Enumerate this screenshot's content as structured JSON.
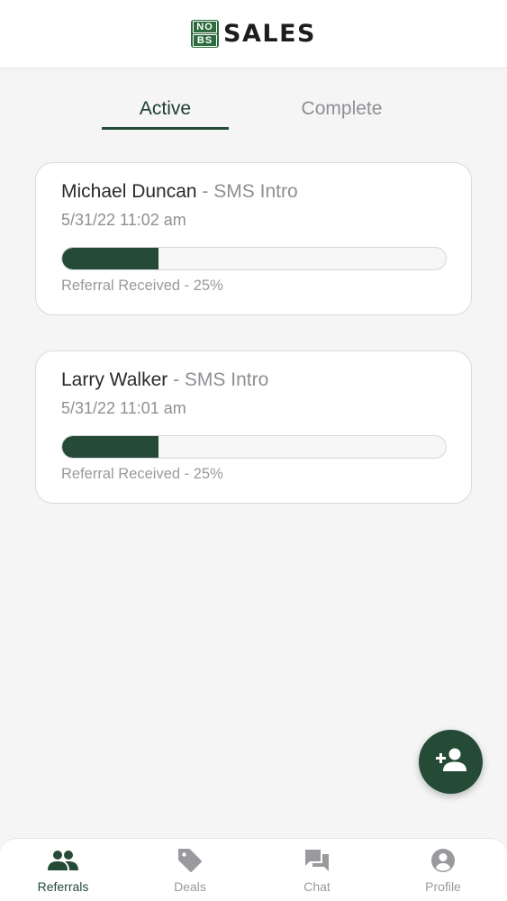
{
  "header": {
    "logo_top": "NO",
    "logo_bottom": "BS",
    "logo_text": "SALES"
  },
  "tabs": [
    {
      "label": "Active",
      "active": true
    },
    {
      "label": "Complete",
      "active": false
    }
  ],
  "referrals": [
    {
      "name": "Michael Duncan",
      "separator": " - ",
      "type": "SMS Intro",
      "date": "5/31/22 11:02 am",
      "progress": 0.25,
      "status": "Referral Received - 25%"
    },
    {
      "name": "Larry Walker",
      "separator": " - ",
      "type": "SMS Intro",
      "date": "5/31/22 11:01 am",
      "progress": 0.25,
      "status": "Referral Received - 25%"
    }
  ],
  "fab": {
    "icon": "add-person-icon"
  },
  "nav": [
    {
      "label": "Referrals",
      "icon": "people-icon",
      "active": true
    },
    {
      "label": "Deals",
      "icon": "tag-icon",
      "active": false
    },
    {
      "label": "Chat",
      "icon": "chat-icon",
      "active": false
    },
    {
      "label": "Profile",
      "icon": "profile-icon",
      "active": false
    }
  ],
  "colors": {
    "brand_green": "#254a36",
    "logo_green": "#2e6b3e",
    "muted_text": "#8f8f94",
    "background": "#f5f5f6"
  }
}
